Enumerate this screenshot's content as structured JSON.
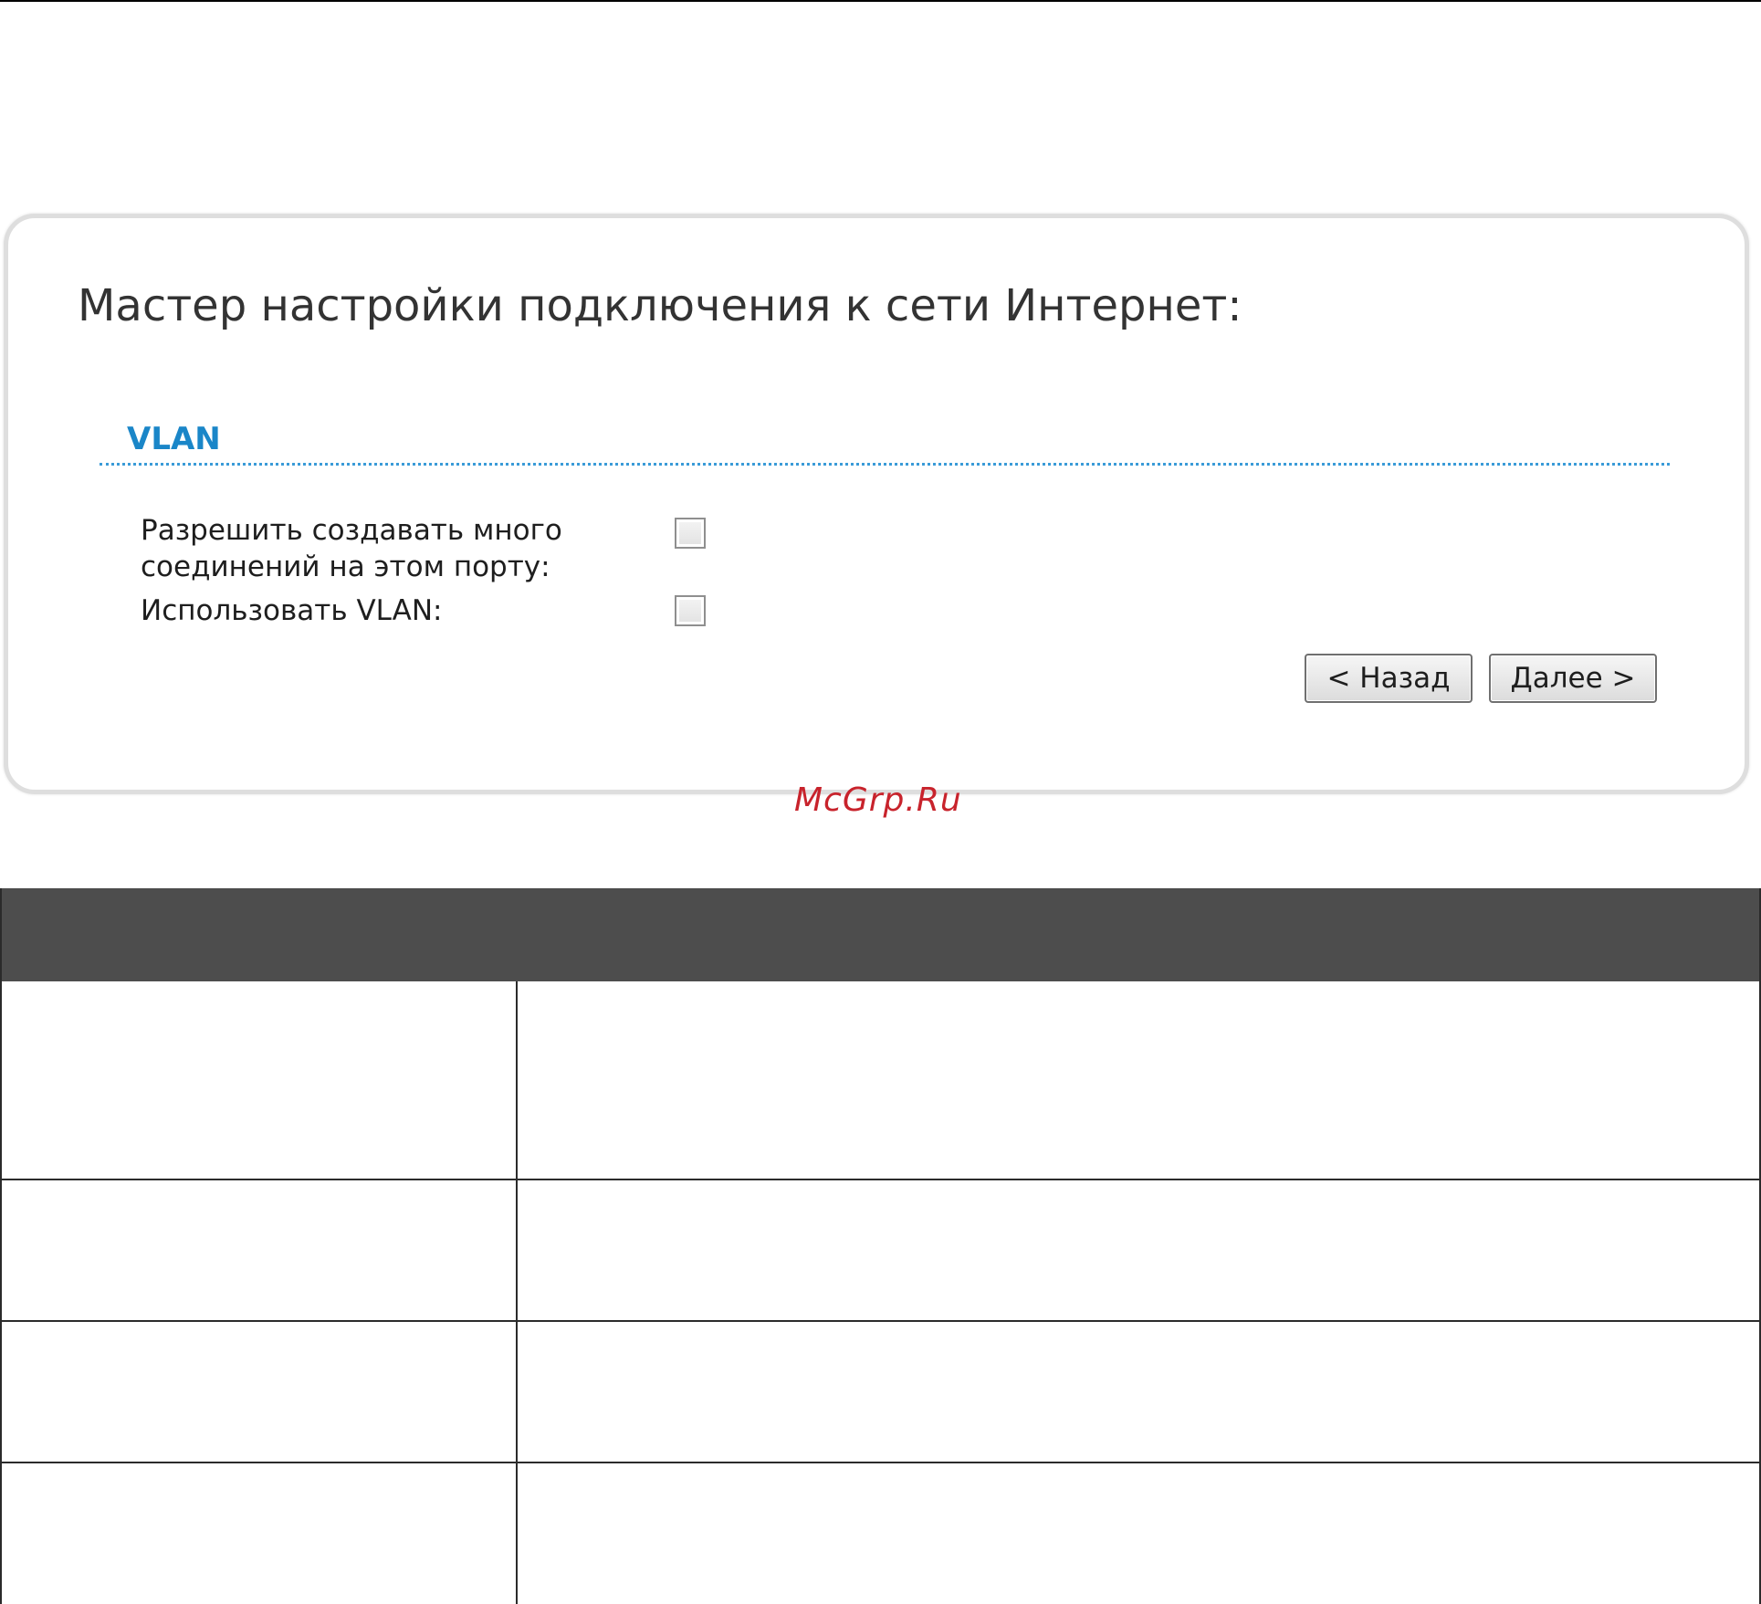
{
  "wizard": {
    "title": "Мастер настройки подключения к сети Интернет:",
    "section_title": "VLAN",
    "fields": [
      {
        "label": "Разрешить создавать много соединений на этом порту:",
        "checked": false
      },
      {
        "label": "Использовать VLAN:",
        "checked": false
      }
    ],
    "buttons": {
      "back": "< Назад",
      "next": "Далее >"
    }
  },
  "watermark": "McGrp.Ru",
  "colors": {
    "section_accent": "#1a86c8",
    "table_header": "#4d4d4d",
    "watermark": "#c8232c"
  }
}
